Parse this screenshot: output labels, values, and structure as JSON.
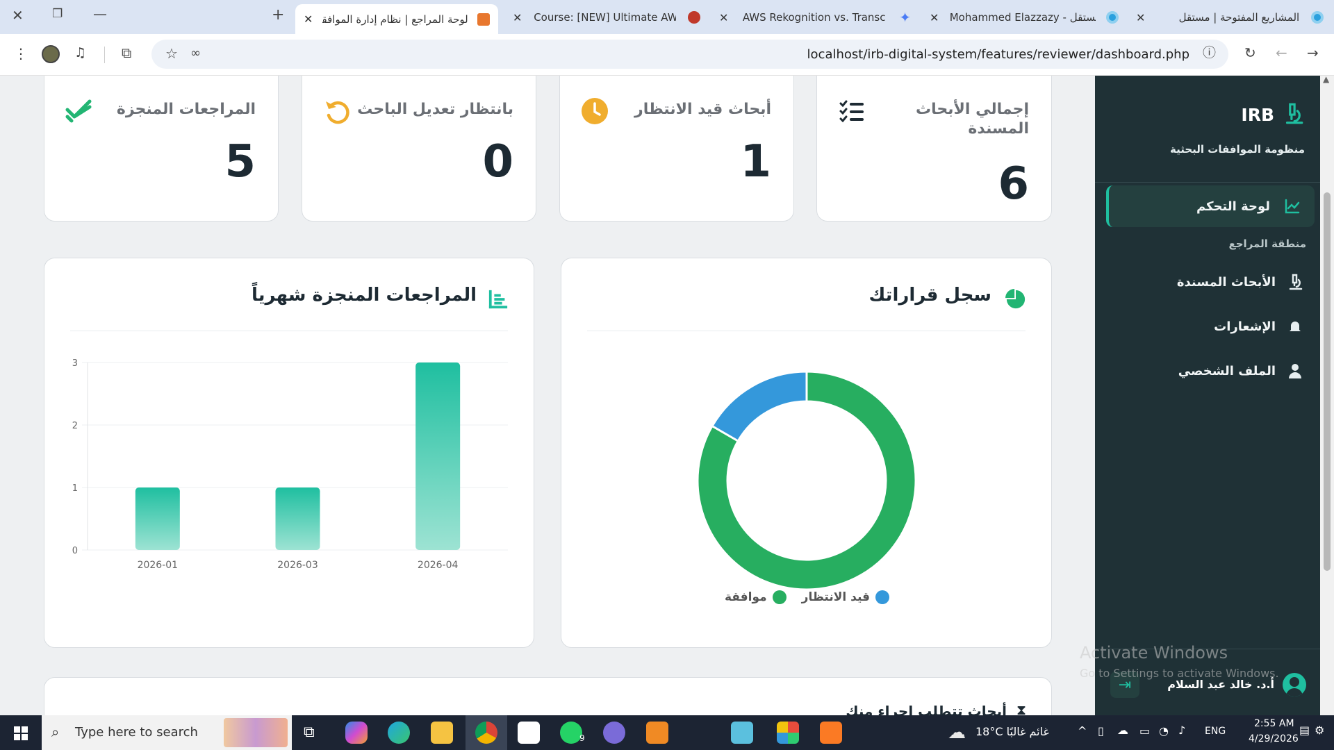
{
  "browser": {
    "tabs": [
      {
        "title": "المشاريع المفتوحة | مستقل",
        "active": false
      },
      {
        "title": "Mohammed Elazzazy - مستقل",
        "active": false
      },
      {
        "title": "AWS Rekognition vs. Transcribe",
        "active": false
      },
      {
        "title": "Course: [NEW] Ultimate AWS Ce",
        "active": false
      },
      {
        "title": "لوحة المراجع | نظام إدارة الموافقات",
        "active": true
      }
    ],
    "url": "localhost/irb-digital-system/features/reviewer/dashboard.php"
  },
  "sidebar": {
    "brand": "IRB",
    "subtitle": "منظومة الموافقات البحثية",
    "items": [
      {
        "label": "لوحة التحكم",
        "icon": "chart-line-icon",
        "active": true
      },
      {
        "label": "الأبحاث المسندة",
        "icon": "microscope-icon",
        "active": false
      },
      {
        "label": "الإشعارات",
        "icon": "bell-icon",
        "active": false
      },
      {
        "label": "الملف الشخصي",
        "icon": "user-icon",
        "active": false
      }
    ],
    "section_label": "منطقة المراجع",
    "user_name": "أ.د. خالد عبد السلام"
  },
  "stats": [
    {
      "title": "إجمالي الأبحاث المسندة",
      "value": "6",
      "icon": "list-check-icon",
      "color": "#1d2a33"
    },
    {
      "title": "أبحاث قيد الانتظار",
      "value": "1",
      "icon": "clock-icon",
      "color": "#f0ad2e"
    },
    {
      "title": "بانتظار تعديل الباحث",
      "value": "0",
      "icon": "undo-icon",
      "color": "#f0ad2e"
    },
    {
      "title": "المراجعات المنجزة",
      "value": "5",
      "icon": "check-double-icon",
      "color": "#22b573"
    }
  ],
  "decisions_panel": {
    "title": "سجل قراراتك",
    "icon": "pie-chart-icon"
  },
  "monthly_panel": {
    "title": "المراجعات المنجزة شهرياً",
    "icon": "bar-chart-icon"
  },
  "bottom_panel_title": "أبحاث تتطلب إجراء منك",
  "chart_data": [
    {
      "type": "pie",
      "variant": "doughnut",
      "labels": [
        "موافقة",
        "قيد الانتظار"
      ],
      "values": [
        5,
        1
      ],
      "colors": [
        "#27ae60",
        "#3498db"
      ],
      "legend": "bottom"
    },
    {
      "type": "bar",
      "categories": [
        "2026-01",
        "2026-03",
        "2026-04"
      ],
      "values": [
        1,
        1,
        3
      ],
      "ylim": [
        0,
        3
      ],
      "yticks": [
        "0",
        "1",
        "2",
        "3"
      ],
      "grid": true,
      "colors": [
        "#1fbfa0",
        "#9de3d3"
      ]
    }
  ],
  "watermarks": {
    "activate_title": "Activate Windows",
    "activate_sub": "Go to Settings to activate Windows."
  },
  "taskbar": {
    "search_placeholder": "Type here to search",
    "weather": "18°C  غائم غالبًا",
    "language": "ENG",
    "time": "2:55 AM",
    "date": "4/29/2026",
    "whatsapp_badge": "9"
  }
}
